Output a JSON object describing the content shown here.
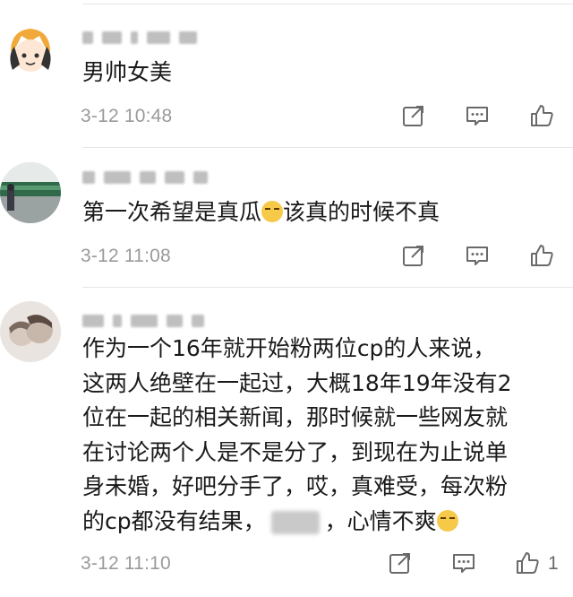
{
  "comments": [
    {
      "text": "男帅女美",
      "time": "3-12 10:48",
      "likes": ""
    },
    {
      "text_before_emoji": "第一次希望是真瓜",
      "text_after_emoji": "该真的时候不真",
      "time": "3-12 11:08",
      "likes": ""
    },
    {
      "lines": [
        "作为一个16年就开始粉两位cp的人来说，",
        "这两人绝壁在一起过，大概18年19年没有2",
        "位在一起的相关新闻，那时候就一些网友就",
        "在讨论两个人是不是分了，到现在为止说单",
        "身未婚，好吧分手了，哎，真难受，每次粉"
      ],
      "last_line_before_blur": "的cp都没有结果，",
      "last_line_after_blur": "，心情不爽",
      "time": "3-12 11:10",
      "likes": "1"
    }
  ],
  "icons": {
    "share": "share-icon",
    "reply": "comment-icon",
    "like": "thumbs-up-icon"
  },
  "colors": {
    "text": "#1a1a1a",
    "meta": "#9a9a9a",
    "icon": "#6a6a6a",
    "divider": "#e6e6e6"
  }
}
